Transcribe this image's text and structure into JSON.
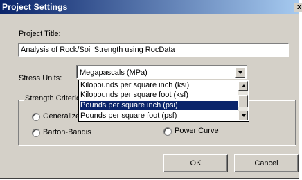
{
  "window": {
    "title": "Project Settings",
    "close_label": "x"
  },
  "project_title": {
    "label": "Project Title:",
    "value": "Analysis of Rock/Soil Strength using RocData"
  },
  "stress_units": {
    "label": "Stress Units:",
    "selected": "Megapascals (MPa)",
    "dropdown_items": [
      "Kilopounds per square inch (ksi)",
      "Kilopounds per square foot (ksf)",
      "Pounds per square inch (psi)",
      "Pounds per square foot (psf)"
    ],
    "highlighted_item": "Pounds per square inch (psi)"
  },
  "strength_criterion": {
    "group_label": "Strength Criterion",
    "options": [
      {
        "label": "Generalized Hoek-Brown"
      },
      {
        "label": "Barton-Bandis"
      },
      {
        "label": "Power Curve"
      }
    ]
  },
  "buttons": {
    "ok": "OK",
    "cancel": "Cancel"
  },
  "colors": {
    "titlebar_start": "#0a246a",
    "titlebar_end": "#a6caf0",
    "dialog_face": "#d4d0c8",
    "selection": "#0a246a"
  }
}
